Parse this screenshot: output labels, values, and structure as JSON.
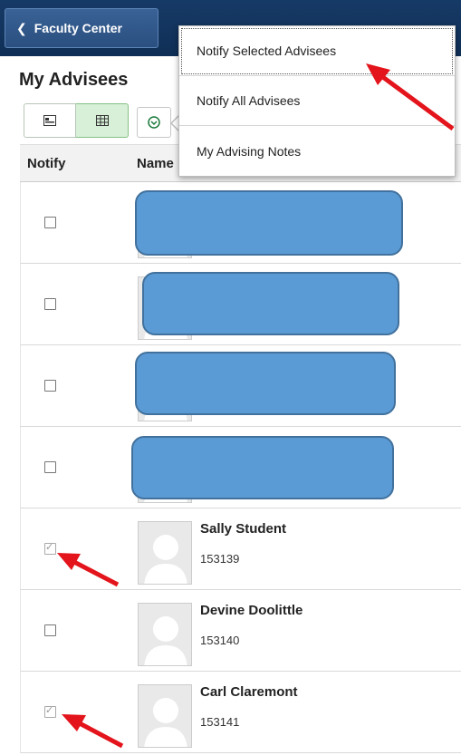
{
  "header": {
    "back_label": "Faculty Center"
  },
  "page": {
    "title": "My Advisees"
  },
  "toolbar": {
    "views": [
      {
        "name": "list-view",
        "icon": "card-list-icon",
        "active": false
      },
      {
        "name": "grid-view",
        "icon": "grid-icon",
        "active": true
      }
    ],
    "actions_icon": "chevron-down-circle-icon"
  },
  "menu": {
    "items": [
      {
        "label": "Notify Selected Advisees",
        "focused": true
      },
      {
        "label": "Notify All Advisees",
        "focused": false
      },
      {
        "label": "My Advising Notes",
        "focused": false
      }
    ]
  },
  "table": {
    "headers": {
      "notify": "Notify",
      "name": "Name"
    },
    "rows": [
      {
        "name": "",
        "id": "",
        "checked": false,
        "redacted": true
      },
      {
        "name": "",
        "id": "",
        "checked": false,
        "redacted": true
      },
      {
        "name": "",
        "id": "",
        "checked": false,
        "redacted": true
      },
      {
        "name": "",
        "id": "",
        "checked": false,
        "redacted": true
      },
      {
        "name": "Sally Student",
        "id": "153139",
        "checked": true,
        "redacted": false
      },
      {
        "name": "Devine Doolittle",
        "id": "153140",
        "checked": false,
        "redacted": false
      },
      {
        "name": "Carl Claremont",
        "id": "153141",
        "checked": true,
        "redacted": false
      }
    ]
  },
  "colors": {
    "header_bg": "#163a66",
    "active_view": "#d7f0d7",
    "redaction_fill": "#5b9bd5",
    "annotation_arrow": "#e3141b"
  }
}
